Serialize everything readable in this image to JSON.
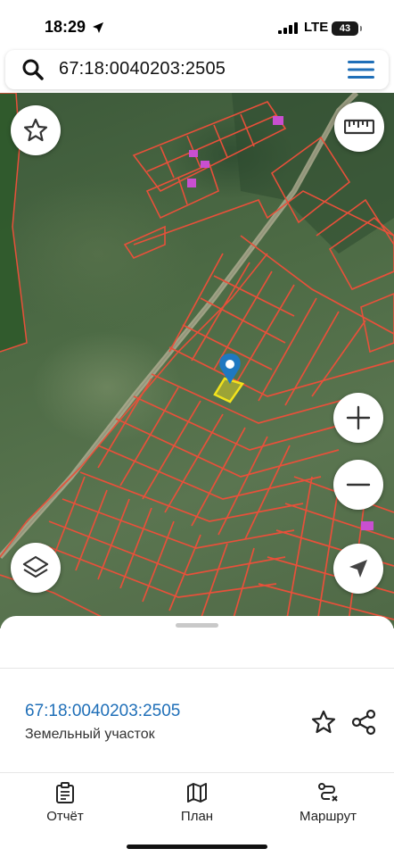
{
  "status_bar": {
    "time": "18:29",
    "network": "LTE",
    "battery": "43",
    "icons": [
      "location-arrow-icon",
      "signal-bars-icon",
      "battery-icon"
    ]
  },
  "search": {
    "query": "67:18:0040203:2505",
    "icons": [
      "search-icon",
      "hamburger-menu-icon"
    ]
  },
  "map": {
    "controls": [
      "star-icon",
      "ruler-icon",
      "plus-icon",
      "minus-icon",
      "layers-icon",
      "navigation-arrow-icon"
    ],
    "parcel_outline_color": "#e8503a",
    "selected_parcel_color": "#f3e21c",
    "marker_color": "#1f78c1"
  },
  "sheet": {
    "parcel_number": "67:18:0040203:2505",
    "parcel_type": "Земельный участок",
    "icons": [
      "star-outline-icon",
      "share-icon"
    ]
  },
  "bottom_nav": {
    "items": [
      {
        "label": "Отчёт",
        "icon": "report-clipboard-icon"
      },
      {
        "label": "План",
        "icon": "map-plan-icon"
      },
      {
        "label": "Маршрут",
        "icon": "route-icon"
      }
    ]
  },
  "colors": {
    "link_blue": "#1f6fb8",
    "menu_blue": "#1f6fb8"
  }
}
